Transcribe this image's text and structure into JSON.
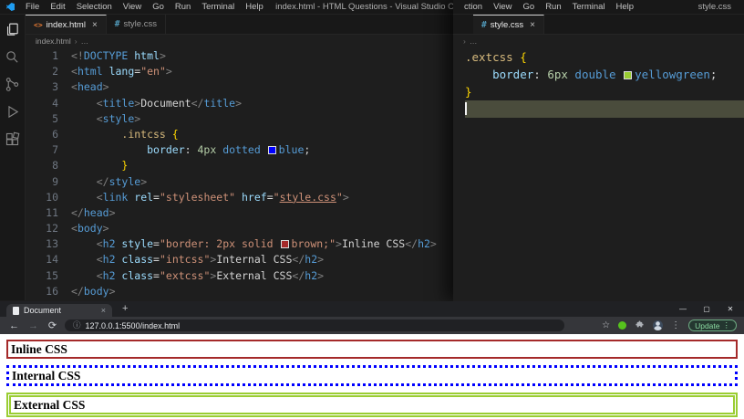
{
  "vscode_left": {
    "menus": [
      "File",
      "Edit",
      "Selection",
      "View",
      "Go",
      "Run",
      "Terminal",
      "Help"
    ],
    "window_title": "index.html - HTML Questions - Visual Studio Code",
    "tabs": [
      {
        "icon": "<>",
        "label": "index.html",
        "close": "×"
      },
      {
        "icon": "#",
        "label": "style.css"
      }
    ],
    "breadcrumb": {
      "file": "index.html",
      "chevron": "›",
      "more": "…"
    },
    "code_lines": [
      {
        "n": "1",
        "segs": [
          [
            "p",
            "<!"
          ],
          [
            "tag",
            "DOCTYPE"
          ],
          [
            "attr",
            " html"
          ],
          [
            "p",
            ">"
          ]
        ]
      },
      {
        "n": "2",
        "segs": [
          [
            "p",
            "<"
          ],
          [
            "tag",
            "html"
          ],
          [
            "attr",
            " lang"
          ],
          [
            "op",
            "="
          ],
          [
            "str",
            "\"en\""
          ],
          [
            "p",
            ">"
          ]
        ]
      },
      {
        "n": "3",
        "segs": [
          [
            "p",
            "<"
          ],
          [
            "tag",
            "head"
          ],
          [
            "p",
            ">"
          ]
        ]
      },
      {
        "n": "4",
        "segs": [
          [
            "txt",
            "    "
          ],
          [
            "p",
            "<"
          ],
          [
            "tag",
            "title"
          ],
          [
            "p",
            ">"
          ],
          [
            "txt",
            "Document"
          ],
          [
            "p",
            "</"
          ],
          [
            "tag",
            "title"
          ],
          [
            "p",
            ">"
          ]
        ]
      },
      {
        "n": "5",
        "segs": [
          [
            "txt",
            "    "
          ],
          [
            "p",
            "<"
          ],
          [
            "tag",
            "style"
          ],
          [
            "p",
            ">"
          ]
        ]
      },
      {
        "n": "6",
        "segs": [
          [
            "txt",
            "        "
          ],
          [
            "sel",
            ".intcss"
          ],
          [
            "txt",
            " "
          ],
          [
            "brace",
            "{"
          ]
        ]
      },
      {
        "n": "7",
        "segs": [
          [
            "txt",
            "            "
          ],
          [
            "prop",
            "border"
          ],
          [
            "op",
            ":"
          ],
          [
            "num",
            " 4px"
          ],
          [
            "kw",
            " dotted "
          ],
          [
            "swatch",
            "#0000ff"
          ],
          [
            "kw",
            "blue"
          ],
          [
            "op",
            ";"
          ]
        ]
      },
      {
        "n": "8",
        "segs": [
          [
            "txt",
            "        "
          ],
          [
            "brace",
            "}"
          ]
        ]
      },
      {
        "n": "9",
        "segs": [
          [
            "txt",
            "    "
          ],
          [
            "p",
            "</"
          ],
          [
            "tag",
            "style"
          ],
          [
            "p",
            ">"
          ]
        ]
      },
      {
        "n": "10",
        "segs": [
          [
            "txt",
            "    "
          ],
          [
            "p",
            "<"
          ],
          [
            "tag",
            "link"
          ],
          [
            "attr",
            " rel"
          ],
          [
            "op",
            "="
          ],
          [
            "str",
            "\"stylesheet\""
          ],
          [
            "attr",
            " href"
          ],
          [
            "op",
            "="
          ],
          [
            "str",
            "\""
          ],
          [
            "strU",
            "style.css"
          ],
          [
            "str",
            "\""
          ],
          [
            "p",
            ">"
          ]
        ]
      },
      {
        "n": "11",
        "segs": [
          [
            "p",
            "</"
          ],
          [
            "tag",
            "head"
          ],
          [
            "p",
            ">"
          ]
        ]
      },
      {
        "n": "12",
        "segs": [
          [
            "p",
            "<"
          ],
          [
            "tag",
            "body"
          ],
          [
            "p",
            ">"
          ]
        ]
      },
      {
        "n": "13",
        "segs": [
          [
            "txt",
            "    "
          ],
          [
            "p",
            "<"
          ],
          [
            "tag",
            "h2"
          ],
          [
            "attr",
            " style"
          ],
          [
            "op",
            "="
          ],
          [
            "str",
            "\"border: 2px solid "
          ],
          [
            "swatch",
            "#a52a2a"
          ],
          [
            "str",
            "brown;\""
          ],
          [
            "p",
            ">"
          ],
          [
            "txt",
            "Inline CSS"
          ],
          [
            "p",
            "</"
          ],
          [
            "tag",
            "h2"
          ],
          [
            "p",
            ">"
          ]
        ]
      },
      {
        "n": "14",
        "segs": [
          [
            "txt",
            "    "
          ],
          [
            "p",
            "<"
          ],
          [
            "tag",
            "h2"
          ],
          [
            "attr",
            " class"
          ],
          [
            "op",
            "="
          ],
          [
            "str",
            "\"intcss\""
          ],
          [
            "p",
            ">"
          ],
          [
            "txt",
            "Internal CSS"
          ],
          [
            "p",
            "</"
          ],
          [
            "tag",
            "h2"
          ],
          [
            "p",
            ">"
          ]
        ]
      },
      {
        "n": "15",
        "segs": [
          [
            "txt",
            "    "
          ],
          [
            "p",
            "<"
          ],
          [
            "tag",
            "h2"
          ],
          [
            "attr",
            " class"
          ],
          [
            "op",
            "="
          ],
          [
            "str",
            "\"extcss\""
          ],
          [
            "p",
            ">"
          ],
          [
            "txt",
            "External CSS"
          ],
          [
            "p",
            "</"
          ],
          [
            "tag",
            "h2"
          ],
          [
            "p",
            ">"
          ]
        ]
      },
      {
        "n": "16",
        "segs": [
          [
            "p",
            "</"
          ],
          [
            "tag",
            "body"
          ],
          [
            "p",
            ">"
          ]
        ]
      }
    ]
  },
  "vscode_right": {
    "menu_partial": "ction",
    "menus": [
      "View",
      "Go",
      "Run",
      "Terminal",
      "Help"
    ],
    "window_title": "style.css",
    "tab": {
      "icon": "#",
      "label": "style.css",
      "close": "×"
    },
    "breadcrumb": {
      "chevron": "›",
      "more": "…"
    },
    "code_lines": [
      {
        "segs": [
          [
            "sel",
            ".extcss"
          ],
          [
            "txt",
            " "
          ],
          [
            "brace",
            "{"
          ]
        ]
      },
      {
        "segs": [
          [
            "txt",
            "    "
          ],
          [
            "prop",
            "border"
          ],
          [
            "op",
            ":"
          ],
          [
            "num",
            " 6px"
          ],
          [
            "kw",
            " double "
          ],
          [
            "swatch",
            "#9acd32"
          ],
          [
            "kw",
            "yellowgreen"
          ],
          [
            "op",
            ";"
          ]
        ]
      },
      {
        "segs": [
          [
            "brace",
            "}"
          ]
        ]
      },
      {
        "segs": [],
        "selected": true,
        "cursor": true
      }
    ]
  },
  "browser": {
    "tab": {
      "title": "Document",
      "close": "×"
    },
    "new_tab_button": "+",
    "window_controls": {
      "minimize": "—",
      "maximize": "▢",
      "close": "✕"
    },
    "nav": {
      "back": "←",
      "forward": "→",
      "reload": "⟳"
    },
    "site_info_icon": "ⓘ",
    "url": "127.0.0.1:5500/index.html",
    "toolbar_icons": {
      "bookmark": "☆",
      "menu": "⋮"
    },
    "update_button": {
      "label": "Update",
      "menu": "⋮"
    },
    "page_headings": [
      {
        "text": "Inline CSS",
        "border_css": "border: 2px solid #a52a2a"
      },
      {
        "text": "Internal CSS",
        "border_css": "border: 3px dotted #0000ff"
      },
      {
        "text": "External CSS",
        "border_css": "border: 5px double #9acd32"
      }
    ]
  },
  "colors": {
    "editor_background": "#1e1e1e",
    "titlebar_background": "#181818",
    "inline_border": "#a52a2a",
    "internal_border": "#0000ff",
    "external_border": "#9acd32",
    "update_green": "#8bdaa2"
  }
}
